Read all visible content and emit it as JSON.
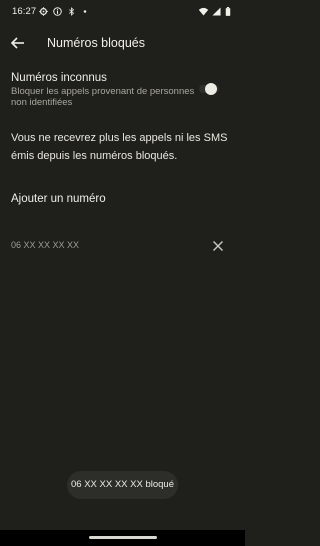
{
  "status_bar": {
    "time": "16:27",
    "left_icons": [
      "settings-gear-icon",
      "info-circle-icon",
      "bluetooth-icon",
      "notification-dot-icon"
    ],
    "right_icons": [
      "wifi-icon",
      "signal-icon",
      "battery-icon"
    ]
  },
  "app_bar": {
    "back_icon": "arrow-back-icon",
    "title": "Numéros bloqués"
  },
  "unknown_numbers": {
    "title": "Numéros inconnus",
    "subtitle": "Bloquer les appels provenant de personnes non identifiées",
    "toggle_on": false
  },
  "info_text": "Vous ne recevrez plus les appels ni les SMS émis depuis les numéros bloqués.",
  "add_number_label": "Ajouter un numéro",
  "blocked_numbers": [
    {
      "number": "06 XX XX XX XX",
      "remove_icon": "close-icon"
    }
  ],
  "snackbar": {
    "text": "06 XX XX XX XX bloqué"
  },
  "colors": {
    "background": "#1f1f1b",
    "primary_text": "#f0efe8",
    "secondary_text": "#a9a89f",
    "snackbar_bg": "#2d2d29"
  }
}
